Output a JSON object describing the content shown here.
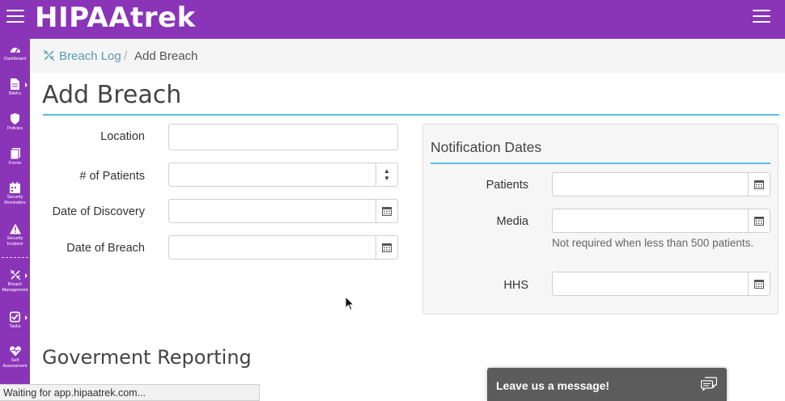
{
  "app": {
    "logo": "HIPAAtrek"
  },
  "sidebar": {
    "items": [
      {
        "label": "Dashboard",
        "icon": "dashboard-icon"
      },
      {
        "label": "BAA's",
        "icon": "document-icon"
      },
      {
        "label": "Policies",
        "icon": "shield-icon"
      },
      {
        "label": "Forms",
        "icon": "forms-icon"
      },
      {
        "label": "Security Reminders",
        "icon": "calendar-icon"
      },
      {
        "label": "Security Incident",
        "icon": "warning-icon"
      },
      {
        "label": "Breach Management",
        "icon": "broken-link-icon"
      },
      {
        "label": "Tasks",
        "icon": "checkbox-icon"
      },
      {
        "label": "Self Assessment",
        "icon": "heartbeat-icon"
      }
    ]
  },
  "breadcrumb": {
    "parent": "Breach Log",
    "separator": "/",
    "current": "Add Breach"
  },
  "page": {
    "title": "Add Breach"
  },
  "form": {
    "location": {
      "label": "Location",
      "value": ""
    },
    "patients_count": {
      "label": "# of Patients",
      "value": ""
    },
    "date_discovery": {
      "label": "Date of Discovery",
      "value": ""
    },
    "date_breach": {
      "label": "Date of Breach",
      "value": ""
    }
  },
  "notification": {
    "title": "Notification Dates",
    "patients": {
      "label": "Patients",
      "value": ""
    },
    "media": {
      "label": "Media",
      "value": "",
      "help": "Not required when less than 500 patients."
    },
    "hhs": {
      "label": "HHS",
      "value": ""
    }
  },
  "sections": {
    "government_reporting": "Goverment Reporting"
  },
  "chat": {
    "label": "Leave us a message!"
  },
  "status": {
    "text": "Waiting for app.hipaatrek.com..."
  },
  "colors": {
    "brand": "#8a35b8",
    "accent": "#5bc0de",
    "link": "#5b9ab5"
  }
}
